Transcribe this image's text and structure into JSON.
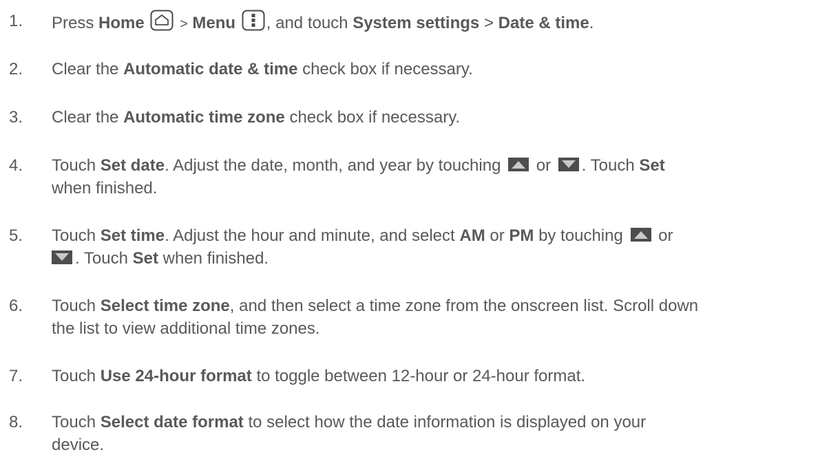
{
  "steps": [
    {
      "number": "1.",
      "t_press": "Press",
      "home": "Home",
      "gt1": ">",
      "menu": "Menu",
      "t_touch": ", and touch",
      "system_settings": "System settings",
      "gt2": ">",
      "date_time": "Date & time",
      "period": "."
    },
    {
      "number": "2.",
      "t1": "Clear the",
      "bold": "Automatic date & time",
      "t2": "check box if necessary."
    },
    {
      "number": "3.",
      "t1": "Clear the",
      "bold": "Automatic time zone",
      "t2": "check box if necessary."
    },
    {
      "number": "4.",
      "t1": "Touch",
      "set_date": "Set date",
      "t2": ". Adjust the date, month, and year by touching",
      "or": "or",
      "t3": ". Touch",
      "set": "Set",
      "t4": "when finished."
    },
    {
      "number": "5.",
      "t1": "Touch",
      "set_time": "Set time",
      "t2": ". Adjust the hour and minute, and select",
      "am": "AM",
      "t_or1": "or",
      "pm": "PM",
      "t3": "by touching",
      "or": "or",
      "t4": ". Touch",
      "set": "Set",
      "t5": "when finished."
    },
    {
      "number": "6.",
      "t1": "Touch",
      "bold": "Select time zone",
      "t2": ", and then select a time zone from the onscreen list. Scroll down",
      "t3": "the list to view additional time zones."
    },
    {
      "number": "7.",
      "t1": "Touch",
      "bold": "Use 24-hour format",
      "t2": "to toggle between 12-hour or 24-hour format."
    },
    {
      "number": "8.",
      "t1": "Touch",
      "bold": "Select date format",
      "t2": "to select how the date information is displayed on your",
      "t3": "device."
    }
  ],
  "icons": {
    "home": "home-key-icon",
    "menu": "menu-key-icon",
    "up": "up-arrow-icon",
    "down": "down-arrow-icon"
  },
  "colors": {
    "text": "#595959",
    "icon_outline": "#4a4a4a",
    "arrow_bg": "#4d4d4d"
  }
}
